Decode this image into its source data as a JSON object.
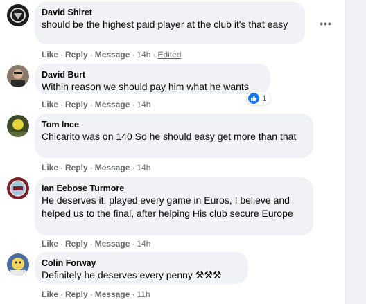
{
  "comments": [
    {
      "author": "David Shiret",
      "text": "should be the highest paid player at the club it's that easy",
      "actions": {
        "like": "Like",
        "reply": "Reply",
        "message": "Message",
        "time": "14h",
        "edited": "Edited"
      },
      "more": "•••"
    },
    {
      "author": "David Burt",
      "text": "Within reason we should pay him what he wants",
      "actions": {
        "like": "Like",
        "reply": "Reply",
        "message": "Message",
        "time": "14h"
      },
      "reactions": {
        "icon": "thumbs-up-icon",
        "count": "1"
      }
    },
    {
      "author": "Tom Ince",
      "text": "Chicarito was on 140 So he should easy get more than that",
      "actions": {
        "like": "Like",
        "reply": "Reply",
        "message": "Message",
        "time": "14h"
      }
    },
    {
      "author": "Ian Eebose Turmore",
      "text": "He deserves it, played every game in Euros, I believe and helped us to the final, after helping His club secure Europe",
      "actions": {
        "like": "Like",
        "reply": "Reply",
        "message": "Message",
        "time": "14h"
      }
    },
    {
      "author": "Colin Forway",
      "text": "Definitely he deserves every penny ⚒⚒⚒",
      "actions": {
        "like": "Like",
        "reply": "Reply",
        "message": "Message",
        "time": "11h"
      }
    }
  ],
  "colors": {
    "bubble": "#f0f2f5",
    "meta_text": "#65676b",
    "like_blue": "#1877f2"
  }
}
